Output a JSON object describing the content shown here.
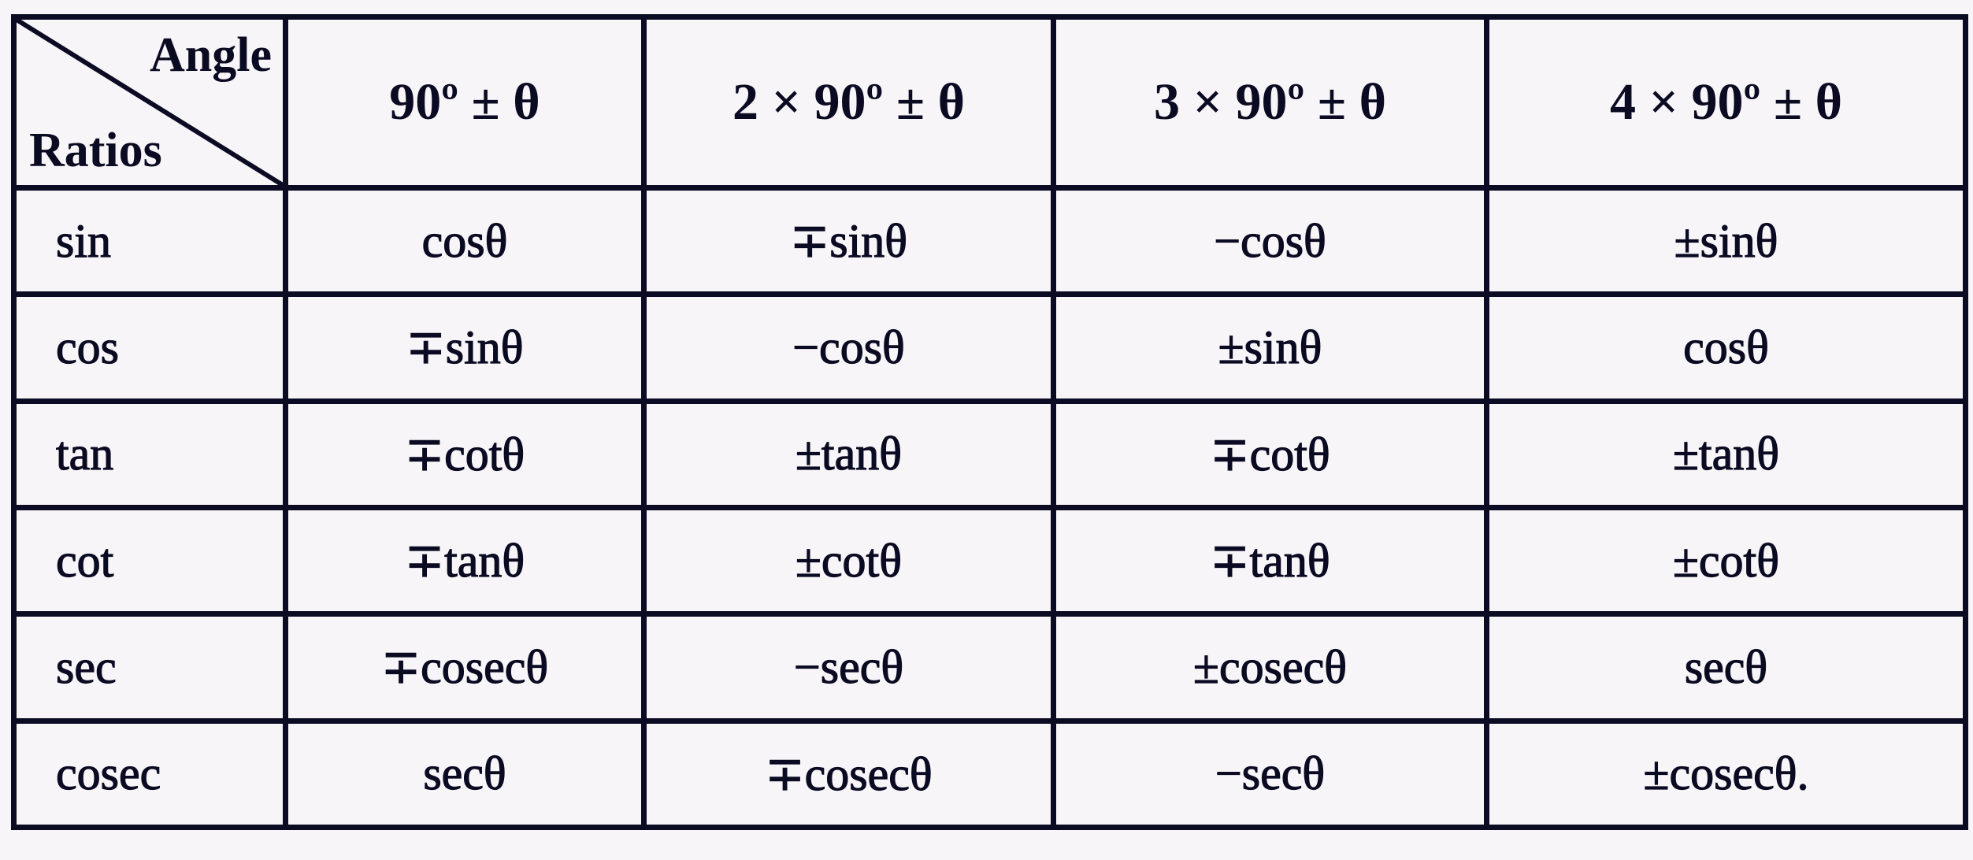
{
  "table": {
    "corner": {
      "top_right_label": "Angle",
      "bottom_left_label": "Ratios"
    },
    "columns": [
      "90º ± θ",
      "2 × 90º ± θ",
      "3 × 90º ± θ",
      "4 × 90º ± θ"
    ],
    "rows": [
      {
        "ratio": "sin",
        "values": [
          "cosθ",
          "∓sinθ",
          "−cosθ",
          "±sinθ"
        ]
      },
      {
        "ratio": "cos",
        "values": [
          "∓sinθ",
          "−cosθ",
          "±sinθ",
          "cosθ"
        ]
      },
      {
        "ratio": "tan",
        "values": [
          "∓cotθ",
          "±tanθ",
          "∓cotθ",
          "±tanθ"
        ]
      },
      {
        "ratio": "cot",
        "values": [
          "∓tanθ",
          "±cotθ",
          "∓tanθ",
          "±cotθ"
        ]
      },
      {
        "ratio": "sec",
        "values": [
          "∓cosecθ",
          "−secθ",
          "±cosecθ",
          "secθ"
        ]
      },
      {
        "ratio": "cosec",
        "values": [
          "secθ",
          "∓cosecθ",
          "−secθ",
          "±cosecθ."
        ]
      }
    ]
  }
}
